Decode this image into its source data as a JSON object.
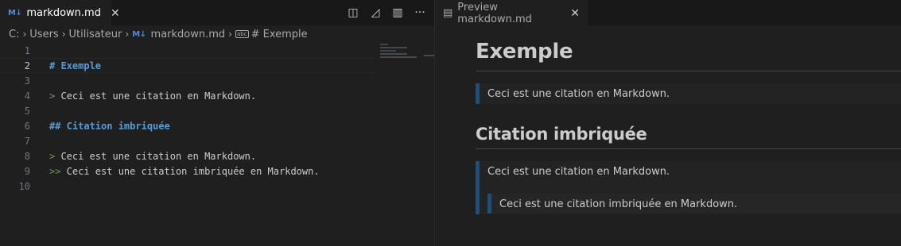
{
  "editor": {
    "tab": {
      "icon": "M↓",
      "title": "markdown.md",
      "close": "✕"
    },
    "actions": [
      {
        "name": "open-preview-side-icon",
        "glyph": "◫"
      },
      {
        "name": "compare-icon",
        "glyph": "◿"
      },
      {
        "name": "split-editor-icon",
        "glyph": "▥"
      },
      {
        "name": "more-actions-icon",
        "glyph": "···"
      }
    ],
    "breadcrumb": {
      "items": [
        "C:",
        "Users",
        "Utilisateur",
        "markdown.md",
        "# Exemple"
      ],
      "separator": "›",
      "file_icon": "M↓",
      "symbol_icon": "abc"
    },
    "lines": [
      {
        "n": "1",
        "text": ""
      },
      {
        "n": "2",
        "text": "# Exemple"
      },
      {
        "n": "3",
        "text": ""
      },
      {
        "n": "4",
        "text": "> Ceci est une citation en Markdown."
      },
      {
        "n": "5",
        "text": ""
      },
      {
        "n": "6",
        "text": "## Citation imbriquée"
      },
      {
        "n": "7",
        "text": ""
      },
      {
        "n": "8",
        "text": "> Ceci est une citation en Markdown."
      },
      {
        "n": "9",
        "text": ">> Ceci est une citation imbriquée en Markdown."
      },
      {
        "n": "10",
        "text": ""
      }
    ]
  },
  "preview": {
    "tab": {
      "title": "Preview markdown.md",
      "close": "✕",
      "icon": "▤"
    },
    "h1": "Exemple",
    "quote1": "Ceci est une citation en Markdown.",
    "h2": "Citation imbriquée",
    "quote2": "Ceci est une citation en Markdown.",
    "quote2_nested": "Ceci est une citation imbriquée en Markdown."
  },
  "colors": {
    "background": "#1f1f1f",
    "heading_token": "#569cd6",
    "quote_marker": "#6a9955",
    "quote_border": "#1e4f7a"
  }
}
